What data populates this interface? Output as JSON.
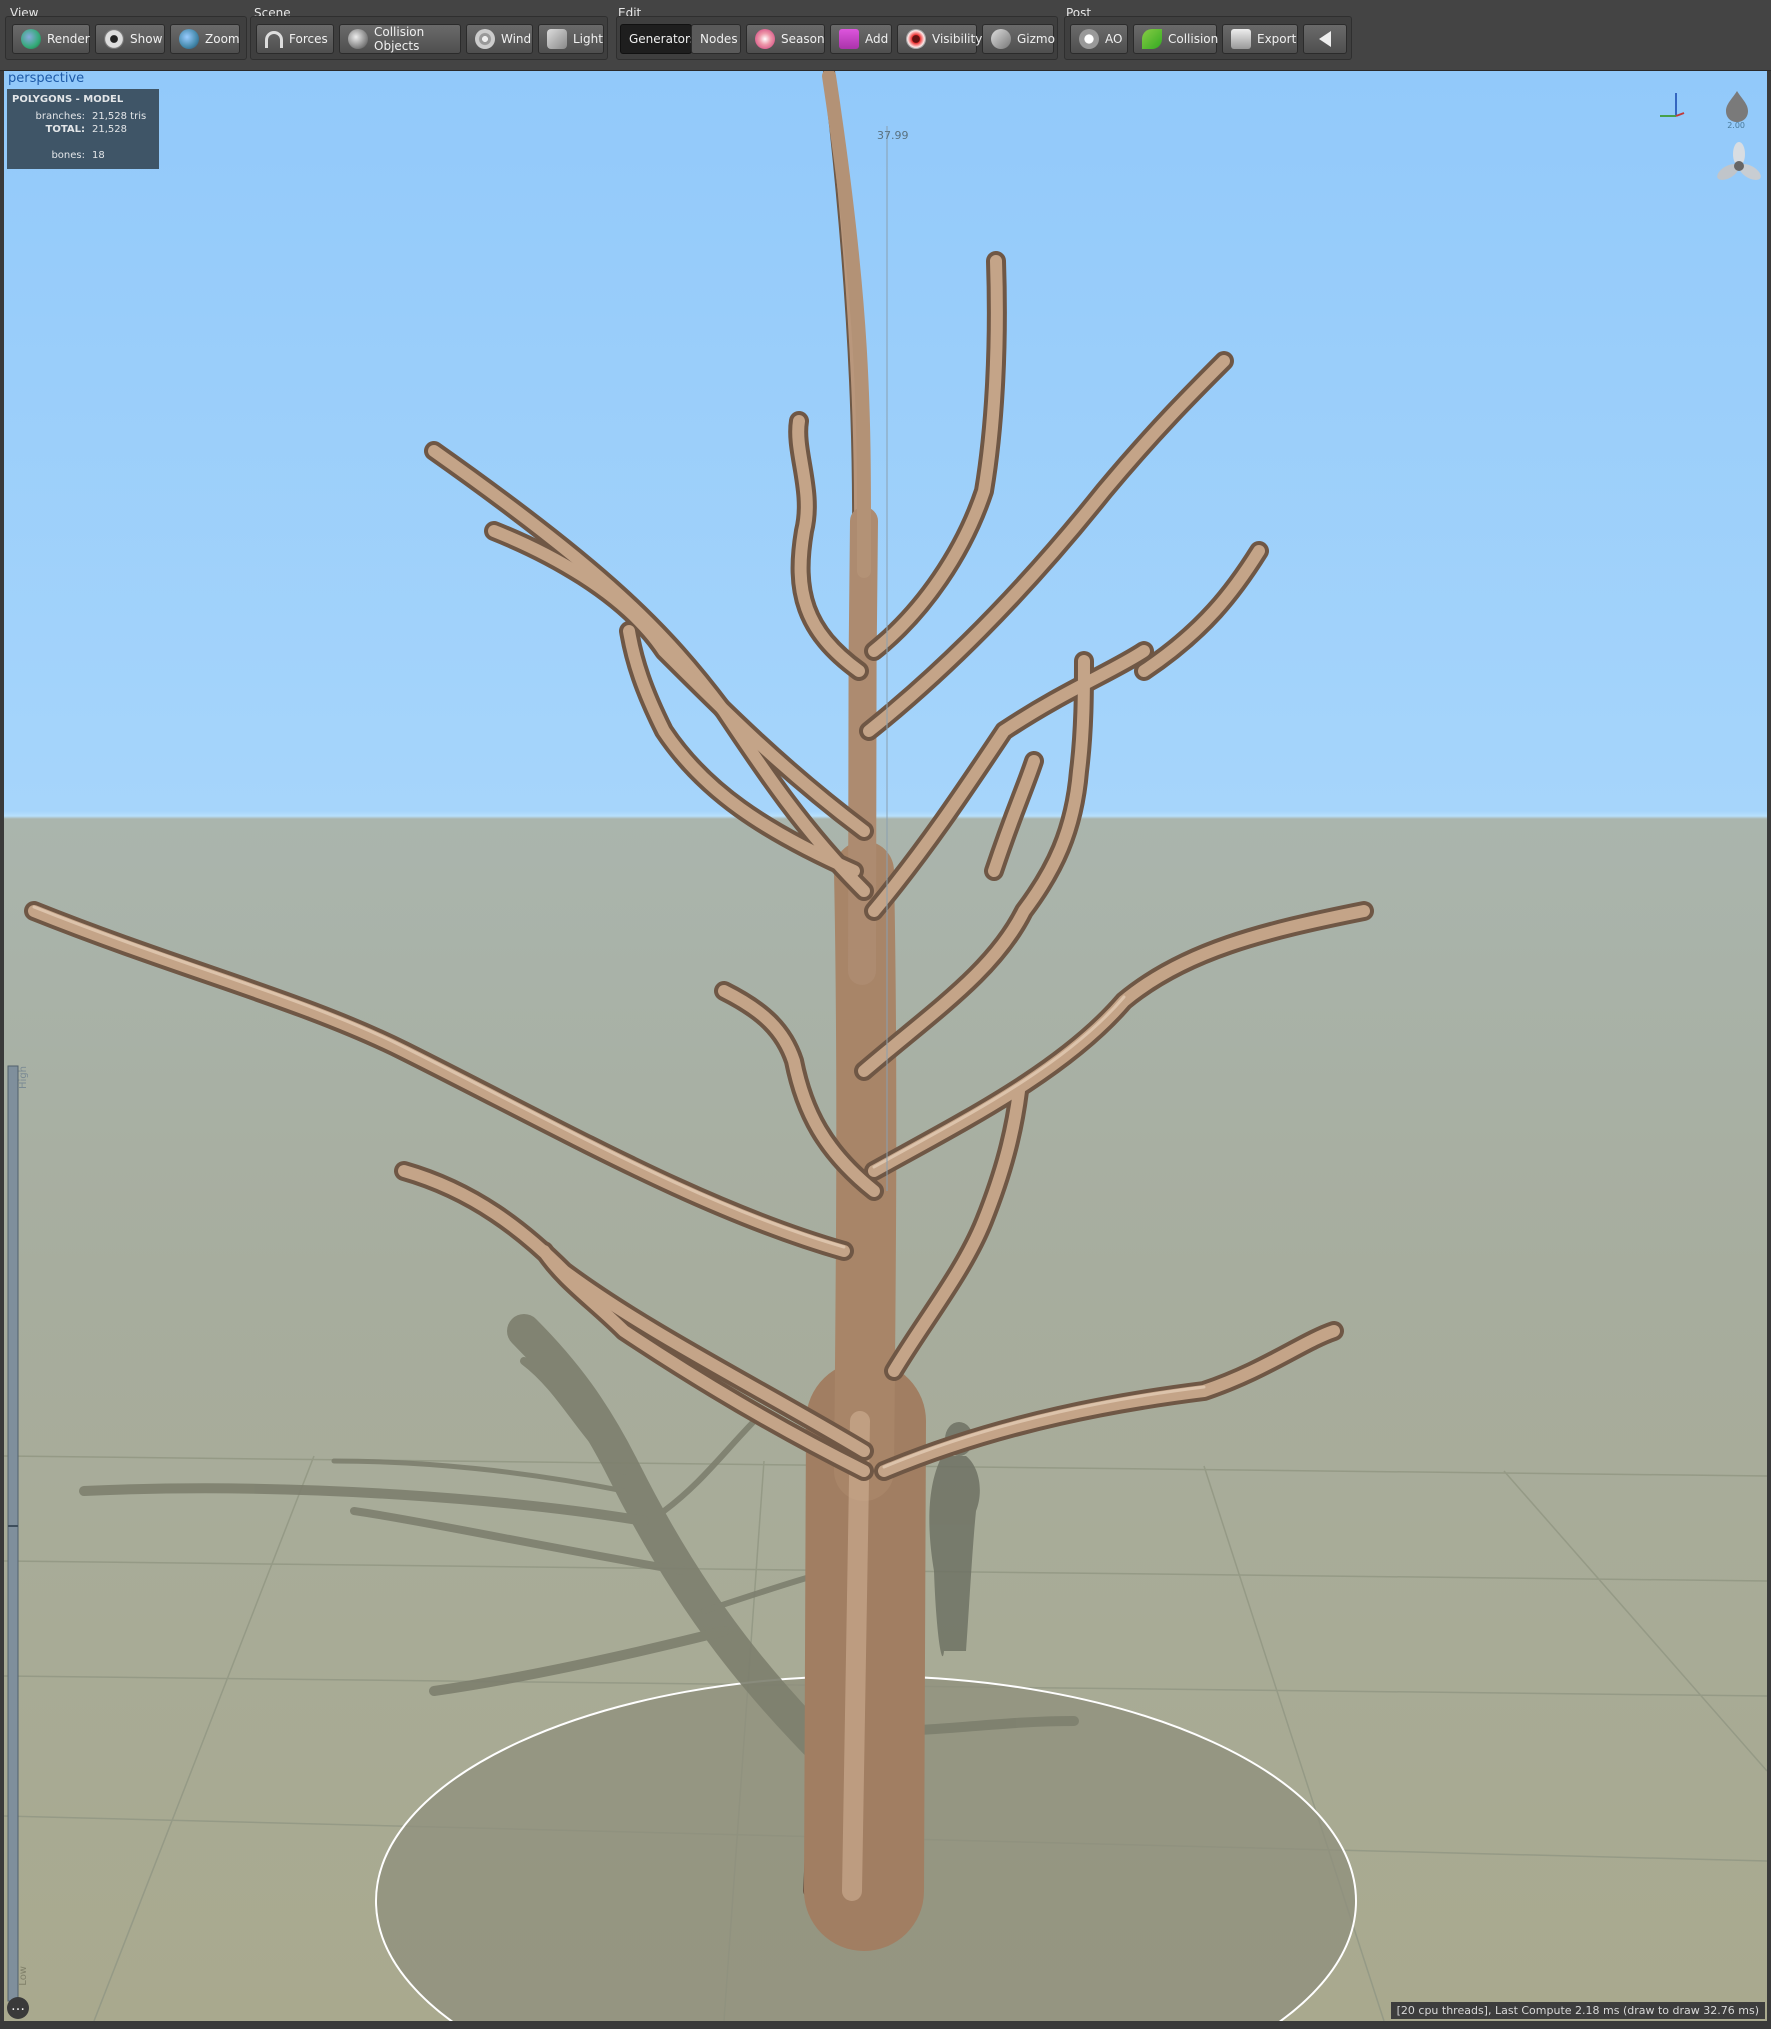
{
  "toolbar": {
    "view": {
      "label": "View",
      "render": "Render",
      "show": "Show",
      "zoom": "Zoom"
    },
    "scene": {
      "label": "Scene",
      "forces": "Forces",
      "collision_objects": "Collision Objects",
      "wind": "Wind",
      "light": "Light"
    },
    "edit": {
      "label": "Edit",
      "generators": "Generators",
      "nodes": "Nodes",
      "season": "Season",
      "add": "Add",
      "visibility": "Visibility",
      "gizmo": "Gizmo"
    },
    "post": {
      "label": "Post",
      "ao": "AO",
      "collision": "Collision",
      "export": "Export"
    }
  },
  "viewport": {
    "mode": "perspective",
    "stats": {
      "title": "POLYGONS - MODEL",
      "branches_label": "branches:",
      "branches_value": "21,528 tris",
      "total_label": "TOTAL:",
      "total_value": "21,528",
      "bones_label": "bones:",
      "bones_value": "18"
    },
    "height_marker": "37.99",
    "lod_high": "High",
    "lod_low": "Low",
    "axis_scale": "2.00",
    "compute_status": "[20 cpu threads], Last Compute 2.18 ms (draw to draw 32.76 ms)"
  },
  "icons": [
    "globe-icon",
    "eye-icon",
    "zoom-icon",
    "magnet-icon",
    "sphere-icon",
    "wind-icon",
    "light-icon",
    "season-icon",
    "add-icon",
    "visibility-icon",
    "gizmo-icon",
    "ao-icon",
    "leaf-icon",
    "export-icon",
    "back-arrow-icon",
    "axis-gizmo-icon",
    "drop-icon",
    "fan-icon",
    "more-icon"
  ],
  "colors": {
    "sky_top": "#92c9fa",
    "ground": "#a8aa98",
    "bark": "#b89a80",
    "toolbar": "#444444",
    "stats_panel": "#3b4f60"
  }
}
